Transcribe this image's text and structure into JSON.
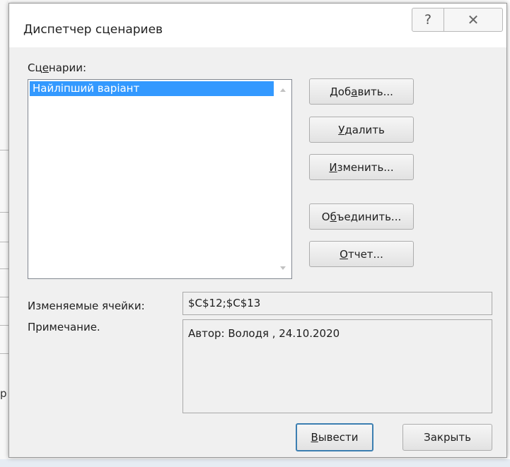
{
  "dialog": {
    "title": "Диспетчер сценариев",
    "help_icon": "question-icon",
    "close_icon": "close-x-icon"
  },
  "scenarios": {
    "label_before": "Сц",
    "label_mnemonic": "е",
    "label_after": "нарии:",
    "items": [
      "Найліпший варіант"
    ],
    "selected_index": 0
  },
  "buttons": {
    "add": {
      "before": "Доб",
      "mnemonic": "а",
      "after": "вить..."
    },
    "delete": {
      "before": "",
      "mnemonic": "У",
      "after": "далить"
    },
    "edit": {
      "before": "",
      "mnemonic": "И",
      "after": "зменить..."
    },
    "merge": {
      "before": "О",
      "mnemonic": "б",
      "after": "ъединить..."
    },
    "report": {
      "before": "",
      "mnemonic": "О",
      "after": "тчет..."
    },
    "show": {
      "before": "",
      "mnemonic": "В",
      "after": "ывести"
    },
    "close": {
      "label": "Закрыть"
    }
  },
  "details": {
    "changing_cells_label": "Изменяемые ячейки:",
    "changing_cells_value": "$C$12;$C$13",
    "comment_label": "Примечание.",
    "comment_value": "Автор: Володя , 24.10.2020"
  },
  "background": {
    "cut_char": "р"
  }
}
